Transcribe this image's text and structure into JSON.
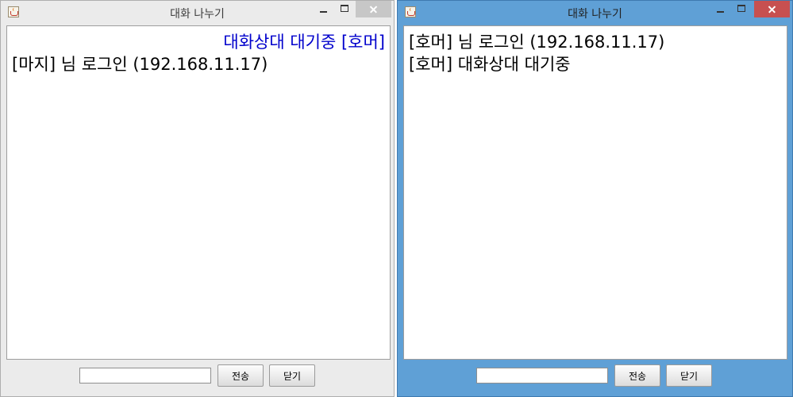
{
  "windows": [
    {
      "title": "대화 나누기",
      "messages": [
        {
          "text": "대화상대 대기중 [호머]",
          "align": "right",
          "color": "#0000cc"
        },
        {
          "text": "[마지] 님 로그인 (192.168.11.17)",
          "align": "left",
          "color": "#000000"
        }
      ],
      "input_value": "",
      "send_label": "전송",
      "close_label": "닫기"
    },
    {
      "title": "대화 나누기",
      "messages": [
        {
          "text": "[호머] 님 로그인 (192.168.11.17)",
          "align": "left",
          "color": "#000000"
        },
        {
          "text": "[호머] 대화상대 대기중",
          "align": "left",
          "color": "#000000"
        }
      ],
      "input_value": "",
      "send_label": "전송",
      "close_label": "닫기"
    }
  ],
  "icons": {
    "app": "java-coffee-icon",
    "minimize": "minimize-icon",
    "maximize": "maximize-icon",
    "close": "close-icon"
  },
  "colors": {
    "active_frame": "#5fa0d6",
    "inactive_frame": "#ebebeb",
    "highlight_text": "#0000cc",
    "active_close": "#c75050"
  }
}
